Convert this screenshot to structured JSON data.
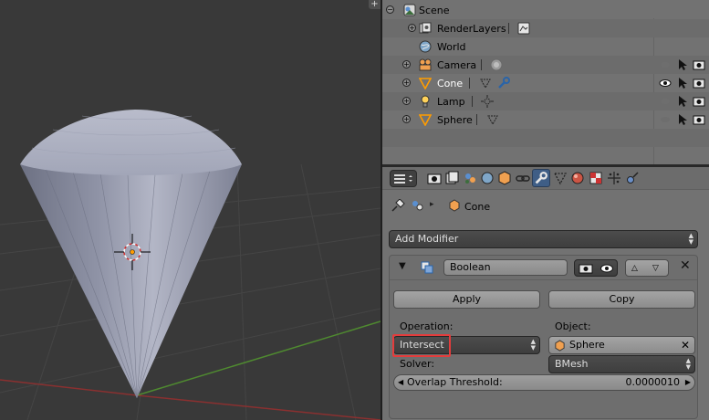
{
  "outliner": {
    "rows": [
      {
        "label": "Scene",
        "icon": "scene-icon"
      },
      {
        "label": "RenderLayers",
        "icon": "render-layers-icon"
      },
      {
        "label": "World",
        "icon": "world-icon"
      },
      {
        "label": "Camera",
        "icon": "camera-icon"
      },
      {
        "label": "Cone",
        "icon": "cone-mesh-icon",
        "active": true
      },
      {
        "label": "Lamp",
        "icon": "lamp-icon"
      },
      {
        "label": "Sphere",
        "icon": "sphere-mesh-icon"
      }
    ]
  },
  "properties": {
    "active_context": "modifiers",
    "context_tabs": [
      "render-icon",
      "render-layers-icon",
      "scene-icon",
      "world-icon",
      "object-icon",
      "constraints-icon",
      "modifiers-icon",
      "data-icon",
      "material-icon",
      "texture-icon",
      "particles-icon",
      "physics-icon"
    ],
    "breadcrumb": {
      "object": "Cone"
    },
    "add_modifier_label": "Add Modifier",
    "modifier": {
      "name": "Boolean",
      "apply_label": "Apply",
      "copy_label": "Copy",
      "operation_label": "Operation:",
      "operation_value": "Intersect",
      "object_label": "Object:",
      "object_value": "Sphere",
      "solver_label": "Solver:",
      "solver_value": "BMesh",
      "overlap_label": "Overlap Threshold:",
      "overlap_value": "0.0000010"
    }
  },
  "colors": {
    "accent": "#3f5e86",
    "highlight": "#e43c3c",
    "object_origin": "#ff9c00"
  }
}
